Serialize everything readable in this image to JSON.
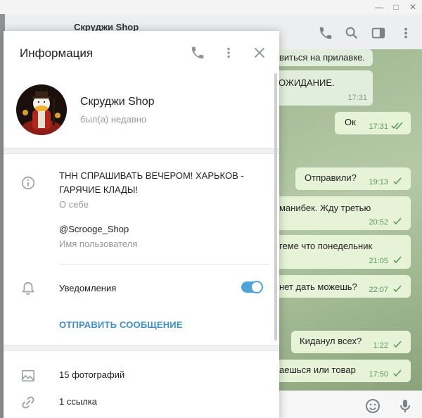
{
  "window": {
    "minimize": "—",
    "maximize": "□",
    "close": "✕"
  },
  "chat": {
    "title": "Скруджи Shop",
    "messages_in": [
      {
        "text": "виться на прилавке."
      },
      {
        "text": "ОЖИДАНИЕ.",
        "time": "17:31"
      }
    ],
    "messages_out": [
      {
        "text": "Ок",
        "time": "17:31"
      },
      {
        "text": "Отправили?",
        "time": "19:13"
      },
      {
        "text": "манибек. Жду третью",
        "time": "20:52"
      },
      {
        "text": "геме что понедельник",
        "time": "21:05"
      },
      {
        "text": "нет дать можешь?",
        "time": "22:07"
      },
      {
        "text": "Киданул всех?",
        "time": "1:22"
      },
      {
        "text": "аешься или товар",
        "time": "17:50"
      }
    ]
  },
  "panel": {
    "title": "Информация",
    "name": "Скруджи Shop",
    "status": "был(а) недавно",
    "about_text": "ТНН СПРАШИВАТЬ ВЕЧЕРОМ! ХАРЬКОВ - ГАРЯЧИЕ КЛАДЫ!",
    "about_label": "О себе",
    "username": "@Scrooge_Shop",
    "username_label": "Имя пользователя",
    "notifications_label": "Уведомления",
    "notifications_on": true,
    "send_message": "ОТПРАВИТЬ СООБЩЕНИЕ",
    "photos": "15 фотографий",
    "links": "1 ссылка"
  },
  "colors": {
    "accent": "#4ea4d9",
    "link": "#3b8fcb",
    "bubble_out": "#e6f3d6",
    "check": "#5a9a5a"
  },
  "icons": [
    "phone-icon",
    "more-vert-icon",
    "close-icon",
    "info-icon",
    "bell-icon",
    "photo-icon",
    "link-icon",
    "search-icon",
    "sidebar-toggle-icon",
    "emoji-icon",
    "microphone-icon"
  ]
}
